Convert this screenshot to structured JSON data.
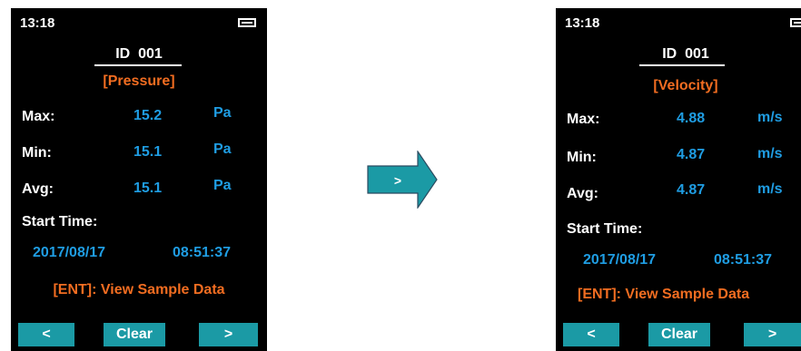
{
  "left_screen": {
    "time": "13:18",
    "device_id": "ID  001",
    "mode": "[Pressure]",
    "stats": [
      {
        "label": "Max:",
        "value": "15.2",
        "unit": "Pa"
      },
      {
        "label": "Min:",
        "value": "15.1",
        "unit": "Pa"
      },
      {
        "label": "Avg:",
        "value": "15.1",
        "unit": "Pa"
      }
    ],
    "start_time_label": "Start Time:",
    "start_date": "2017/08/17",
    "start_clock": "08:51:37",
    "hint": "[ENT]: View Sample Data",
    "buttons": {
      "prev": "<",
      "clear": "Clear",
      "next": ">"
    }
  },
  "right_screen": {
    "time": "13:18",
    "device_id": "ID  001",
    "mode": "[Velocity]",
    "stats": [
      {
        "label": "Max:",
        "value": "4.88",
        "unit": "m/s"
      },
      {
        "label": "Min:",
        "value": "4.87",
        "unit": "m/s"
      },
      {
        "label": "Avg:",
        "value": "4.87",
        "unit": "m/s"
      }
    ],
    "start_time_label": "Start Time:",
    "start_date": "2017/08/17",
    "start_clock": "08:51:37",
    "hint": "[ENT]: View Sample Data",
    "buttons": {
      "prev": "<",
      "clear": "Clear",
      "next": ">"
    }
  },
  "transition_arrow": {
    "label": ">"
  },
  "colors": {
    "screen_bg": "#000000",
    "value_blue": "#1f9de3",
    "accent_orange": "#f26d21",
    "button_teal": "#1b9aa5",
    "arrow_fill": "#1b9aa5"
  }
}
